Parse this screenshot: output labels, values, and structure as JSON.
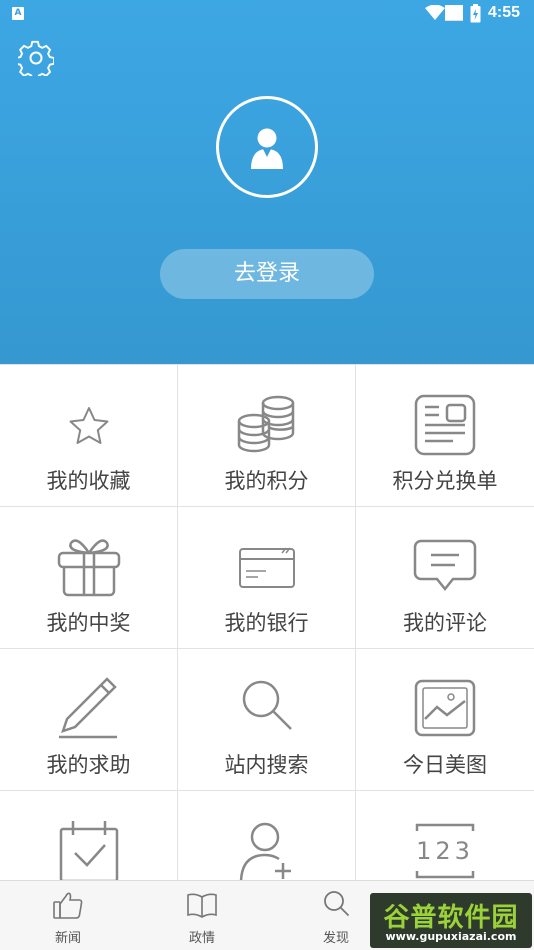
{
  "status_bar": {
    "time": "4:55",
    "app_badge": "A"
  },
  "header": {
    "settings_icon": "gear-icon",
    "avatar_icon": "person-icon",
    "login_label": "去登录"
  },
  "grid": {
    "items": [
      {
        "label": "我的收藏",
        "icon": "star-icon"
      },
      {
        "label": "我的积分",
        "icon": "coins-icon"
      },
      {
        "label": "积分兑换单",
        "icon": "voucher-icon"
      },
      {
        "label": "我的中奖",
        "icon": "gift-icon"
      },
      {
        "label": "我的银行",
        "icon": "card-icon"
      },
      {
        "label": "我的评论",
        "icon": "comment-icon"
      },
      {
        "label": "我的求助",
        "icon": "pencil-icon"
      },
      {
        "label": "站内搜索",
        "icon": "search-icon"
      },
      {
        "label": "今日美图",
        "icon": "picture-icon"
      },
      {
        "label": "",
        "icon": "calendar-check-icon"
      },
      {
        "label": "",
        "icon": "add-user-icon"
      },
      {
        "label": "",
        "icon": "number-icon",
        "text": "123"
      }
    ]
  },
  "tabbar": {
    "tabs": [
      {
        "label": "新闻",
        "icon": "thumbs-up-icon"
      },
      {
        "label": "政情",
        "icon": "book-icon"
      },
      {
        "label": "发现",
        "icon": "search-icon"
      }
    ]
  },
  "watermark": {
    "title": "谷普软件园",
    "url": "www.gupuxiazai.com"
  },
  "colors": {
    "header_top": "#3da7e4",
    "header_bottom": "#3598d0",
    "icon_gray": "#888888",
    "watermark_green": "#9bd23a"
  }
}
